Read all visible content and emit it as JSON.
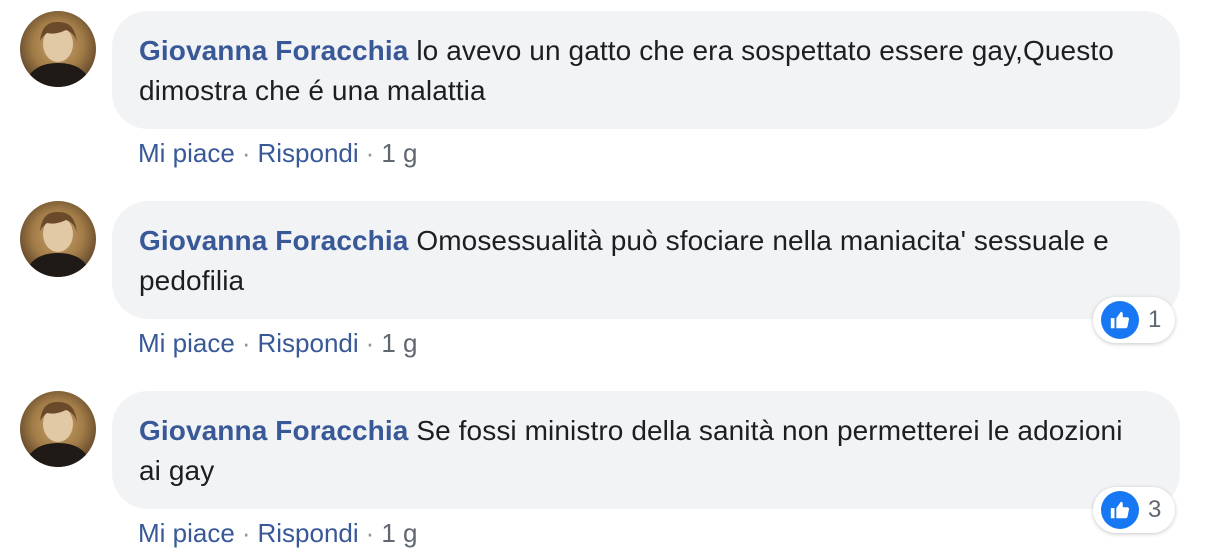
{
  "comments": [
    {
      "author": "Giovanna Foracchia",
      "text": "lo avevo un gatto che era sospettato essere gay,Questo dimostra che é una malattia",
      "actions": {
        "like": "Mi piace",
        "reply": "Rispondi",
        "sep": "·",
        "time": "1 g"
      },
      "reactions": null
    },
    {
      "author": "Giovanna Foracchia",
      "text": "Omosessualità può sfociare nella maniacita' sessuale e pedofilia",
      "actions": {
        "like": "Mi piace",
        "reply": "Rispondi",
        "sep": "·",
        "time": "1 g"
      },
      "reactions": {
        "icon": "like-icon",
        "count": "1"
      }
    },
    {
      "author": "Giovanna Foracchia",
      "text": "Se fossi ministro della sanità non permetterei le adozioni ai gay",
      "actions": {
        "like": "Mi piace",
        "reply": "Rispondi",
        "sep": "·",
        "time": "1 g"
      },
      "reactions": {
        "icon": "like-icon",
        "count": "3"
      }
    }
  ],
  "colors": {
    "author": "#385898",
    "bubble": "#f2f3f5",
    "like": "#1877f2",
    "meta": "#606770"
  }
}
